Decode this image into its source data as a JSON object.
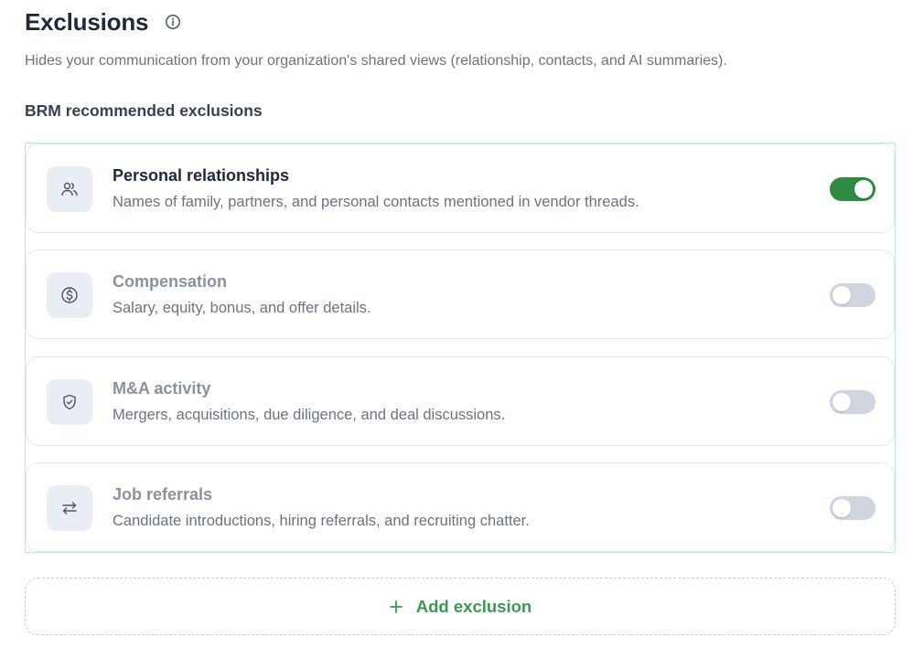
{
  "header": {
    "title": "Exclusions",
    "subtitle": "Hides your communication from your organization's shared views (relationship, contacts, and AI summaries)."
  },
  "section": {
    "heading": "BRM recommended exclusions"
  },
  "exclusions": [
    {
      "title": "Personal relationships",
      "description": "Names of family, partners, and personal contacts mentioned in vendor threads.",
      "icon": "users-icon",
      "enabled": true
    },
    {
      "title": "Compensation",
      "description": "Salary, equity, bonus, and offer details.",
      "icon": "dollar-circle-icon",
      "enabled": false
    },
    {
      "title": "M&A activity",
      "description": "Mergers, acquisitions, due diligence, and deal discussions.",
      "icon": "shield-check-icon",
      "enabled": false
    },
    {
      "title": "Job referrals",
      "description": "Candidate introductions, hiring referrals, and recruiting chatter.",
      "icon": "arrows-swap-icon",
      "enabled": false
    }
  ],
  "add_button": {
    "label": "Add exclusion",
    "icon": "plus-icon"
  },
  "colors": {
    "toggle_on": "#2e8b41",
    "toggle_off": "#d1d5df",
    "accent_green": "#3a9a52",
    "list_border": "#bfe3ef"
  }
}
